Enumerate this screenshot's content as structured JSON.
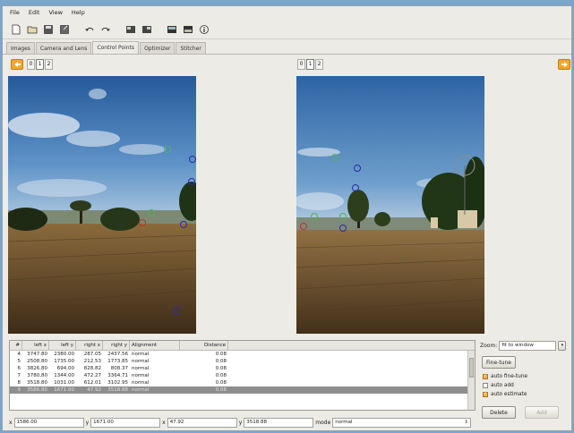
{
  "menu": [
    "File",
    "Edit",
    "View",
    "Help"
  ],
  "toolbar_icons": [
    "new-icon",
    "open-icon",
    "save-icon",
    "save-as-icon",
    "undo-icon",
    "redo-icon",
    "optimize-icon",
    "stitch-icon",
    "preview-icon",
    "fast-preview-icon",
    "info-icon"
  ],
  "tabs": [
    "Images",
    "Camera and Lens",
    "Control Points",
    "Optimizer",
    "Stitcher"
  ],
  "active_tab": "Control Points",
  "left_image_tabs": [
    "0",
    "1",
    "2"
  ],
  "left_active_image": "1",
  "right_image_tabs": [
    "0",
    "1",
    "2"
  ],
  "right_active_image": "1",
  "table": {
    "headers": [
      "#",
      "left x",
      "left y",
      "right x",
      "right y",
      "Alignment",
      "Distance"
    ],
    "rows": [
      [
        "4",
        "3747.80",
        "2380.00",
        "287.05",
        "2437.56",
        "normal",
        "0.08"
      ],
      [
        "5",
        "2508.80",
        "1735.00",
        "212.53",
        "1773.85",
        "normal",
        "0.08"
      ],
      [
        "6",
        "3826.80",
        "694.00",
        "828.82",
        "808.37",
        "normal",
        "0.08"
      ],
      [
        "7",
        "3780.80",
        "1344.00",
        "472.27",
        "3364.71",
        "normal",
        "0.08"
      ],
      [
        "8",
        "3518.80",
        "1031.00",
        "612.01",
        "3102.95",
        "normal",
        "0.08"
      ],
      [
        "9",
        "3586.80",
        "1671.00",
        "47.92",
        "3518.88",
        "normal",
        "0.08"
      ]
    ],
    "selected_row": 5
  },
  "fields": {
    "x_label": "x",
    "x_value": "1586.00",
    "y_label": "y",
    "y_value": "1671.00",
    "x2_label": "x",
    "x2_value": "47.92",
    "y2_label": "y",
    "y2_value": "3518.88",
    "mode_label": "mode",
    "mode_value": "normal"
  },
  "right_panel": {
    "zoom_label": "Zoom:",
    "zoom_value": "fit to window",
    "fine_tune_label": "Fine-tune",
    "checkboxes": [
      {
        "label": "auto fine-tune",
        "checked": true
      },
      {
        "label": "auto add",
        "checked": false
      },
      {
        "label": "auto estimate",
        "checked": true
      }
    ],
    "delete_label": "Delete",
    "add_label": "Add"
  },
  "colors": {
    "accent_arrow": "#f0a830",
    "selected_row": "#8e8e8e",
    "checkbox_on": "#f3b24d"
  }
}
